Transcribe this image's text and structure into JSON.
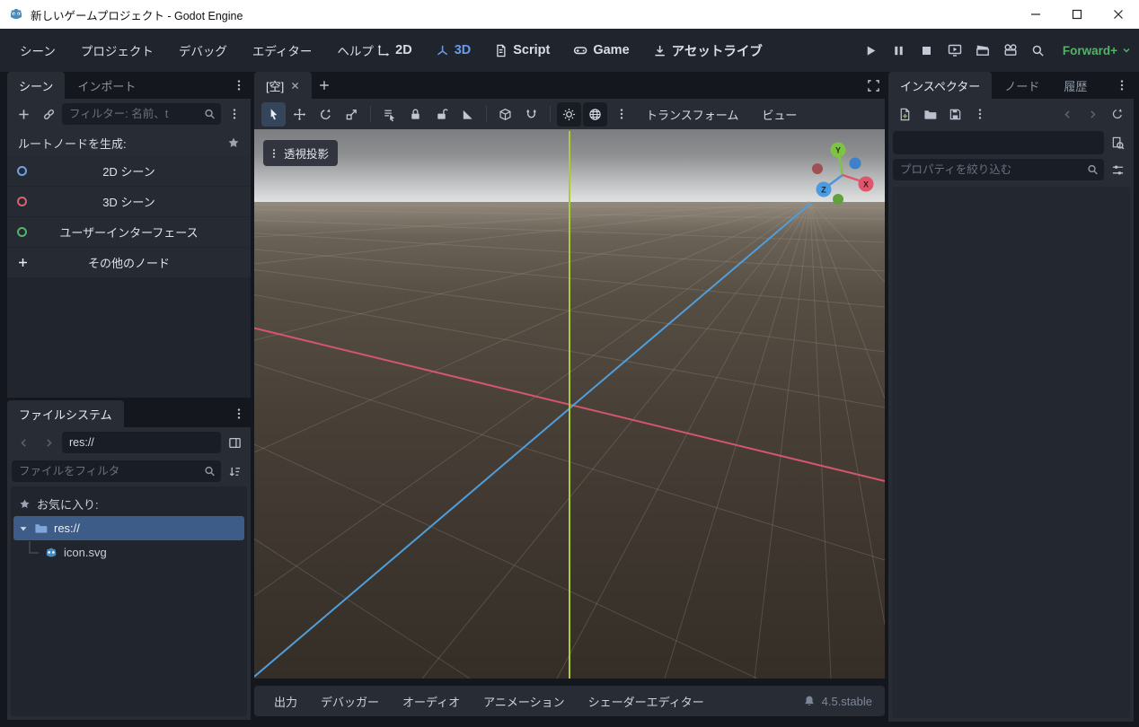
{
  "window": {
    "title": "新しいゲームプロジェクト - Godot Engine"
  },
  "menubar": {
    "items": [
      "シーン",
      "プロジェクト",
      "デバッグ",
      "エディター",
      "ヘルプ"
    ],
    "workspaces": [
      "2D",
      "3D",
      "Script",
      "Game",
      "アセットライブ"
    ],
    "renderer": "Forward+"
  },
  "scene_dock": {
    "tabs": [
      "シーン",
      "インポート"
    ],
    "filter_placeholder": "フィルター: 名前、t",
    "create_root_label": "ルートノードを生成:",
    "create_options": [
      "2D シーン",
      "3D シーン",
      "ユーザーインターフェース",
      "その他のノード"
    ]
  },
  "filesystem_dock": {
    "tab": "ファイルシステム",
    "path": "res://",
    "filter_placeholder": "ファイルをフィルタ",
    "favorites_label": "お気に入り:",
    "items": [
      "res://",
      "icon.svg"
    ]
  },
  "viewport": {
    "tab": "[空]",
    "projection": "透視投影",
    "menus": [
      "トランスフォーム",
      "ビュー"
    ],
    "gizmo": {
      "x": "X",
      "y": "Y",
      "z": "Z"
    }
  },
  "inspector": {
    "tabs": [
      "インスペクター",
      "ノード",
      "履歴"
    ],
    "filter_placeholder": "プロパティを絞り込む"
  },
  "bottom_panel": {
    "tabs": [
      "出力",
      "デバッガー",
      "オーディオ",
      "アニメーション",
      "シェーダーエディター"
    ],
    "version": "4.5.stable"
  },
  "colors": {
    "accent": "#699ce8",
    "renderer_green": "#57b269",
    "selection": "#3d5c88",
    "axis_x": "#d4566d",
    "axis_y": "#a9cc38",
    "axis_z": "#4f9edb"
  }
}
